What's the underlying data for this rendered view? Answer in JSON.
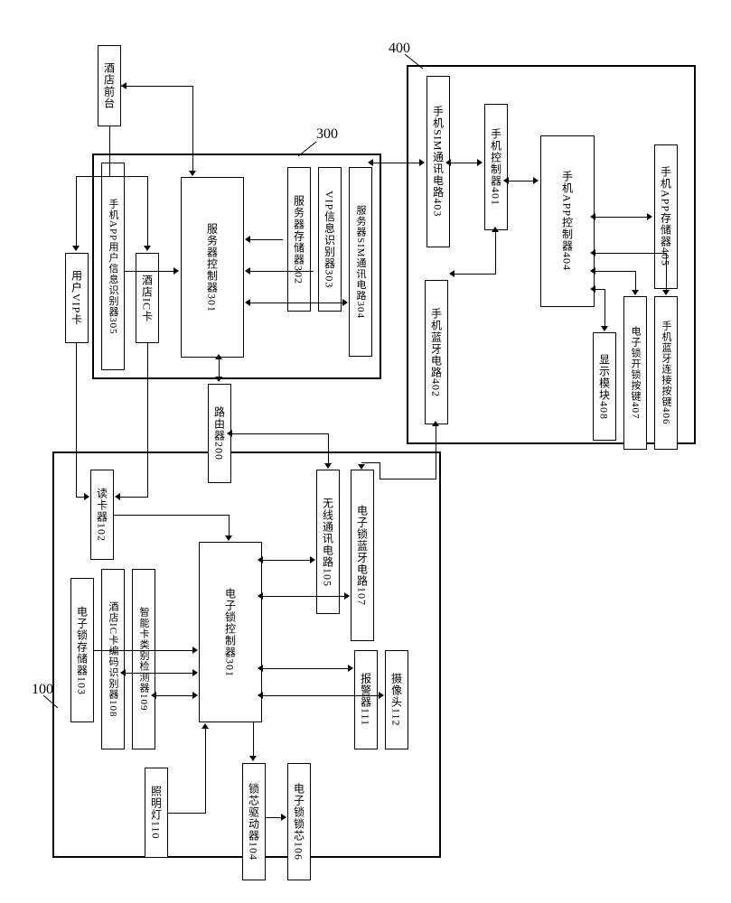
{
  "clusters": {
    "c300_label": "300",
    "c400_label": "400",
    "c100_label": "100"
  },
  "top": {
    "hotel_front": "酒店前台",
    "user_vip_card": "用户VIP卡",
    "hotel_ic_card": "酒店IC卡",
    "router": "路由器200"
  },
  "srv": {
    "app_user_id": "手机APP用户信息识别器305",
    "controller": "服务器控制器301",
    "storage": "服务器存储器302",
    "vip_id": "VIP信息识别器303",
    "sim": "服务器SIM通讯电路304"
  },
  "phone": {
    "sim": "手机SIM通讯电路403",
    "controller": "手机控制器401",
    "bt": "手机蓝牙电路402",
    "app_ctrl": "手机APP控制器404",
    "app_store": "手机APP存储器405",
    "bt_btn": "手机蓝牙连接按键406",
    "unlock_btn": "电子锁开锁按键407",
    "display": "显示模块408"
  },
  "lock": {
    "reader": "读卡器102",
    "controller": "电子锁控制器301",
    "storage": "电子锁存储器103",
    "ic_id": "酒店IC卡编码识别器108",
    "card_type": "智能卡类别检测器109",
    "lamp": "照明灯110",
    "wireless": "无线通讯电路105",
    "bt": "电子锁蓝牙电路107",
    "alarm": "报警器111",
    "camera": "摄像头112",
    "core_drv": "锁芯驱动器104",
    "core": "电子锁锁芯106"
  }
}
